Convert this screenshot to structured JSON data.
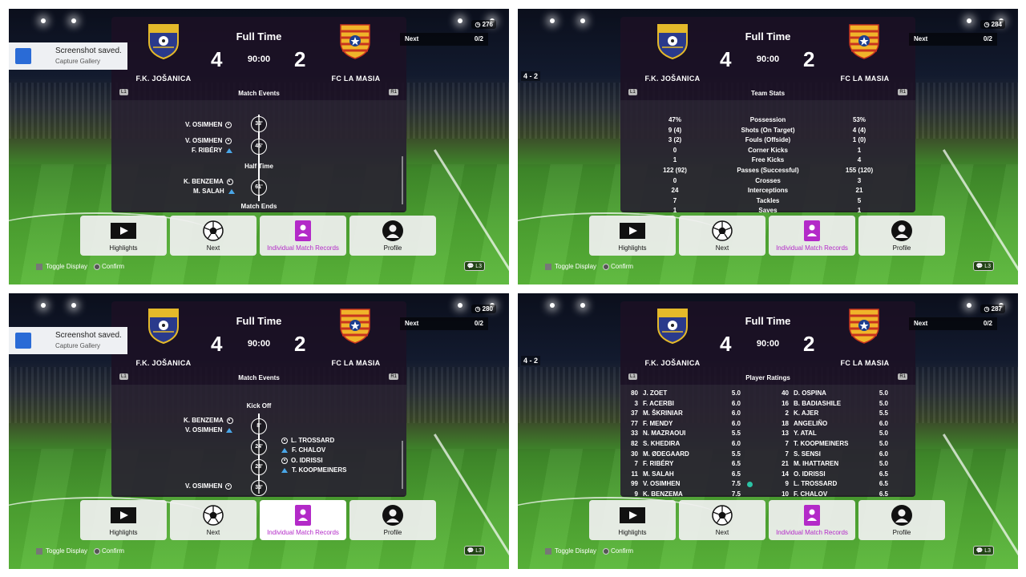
{
  "header": {
    "fulltime": "Full Time",
    "clock": "90:00",
    "home_team": "F.K. JOŠANICA",
    "away_team": "FC LA MASIA",
    "home_score": "4",
    "away_score": "2",
    "l1": "L1",
    "r1": "R1"
  },
  "nav": {
    "next_label": "Next",
    "next_count": "0/2"
  },
  "buttons": {
    "highlights": "Highlights",
    "next": "Next",
    "records": "Individual Match Records",
    "profile": "Profile"
  },
  "footer": {
    "toggle": "Toggle Display",
    "confirm": "Confirm",
    "l3": "L3"
  },
  "toast": {
    "title": "Screenshot saved.",
    "subtitle": "Capture Gallery"
  },
  "thumb_score": "4 - 2",
  "panels": [
    {
      "viewers": "276",
      "section": "Match Events",
      "half_time": "Half Time",
      "match_ends": "Match Ends",
      "events": [
        {
          "home": "V. OSIMHEN",
          "minute": "33'"
        },
        {
          "home": "V. OSIMHEN",
          "home2": "F. RIBÉRY",
          "minute": "45'"
        },
        {
          "home": "K. BENZEMA",
          "home2": "M. SALAH",
          "minute": "61'"
        }
      ]
    },
    {
      "viewers": "284",
      "section": "Team Stats",
      "stats": [
        {
          "l": "47%",
          "m": "Possession",
          "r": "53%"
        },
        {
          "l": "9 (4)",
          "m": "Shots (On Target)",
          "r": "4 (4)"
        },
        {
          "l": "3 (2)",
          "m": "Fouls (Offside)",
          "r": "1 (0)"
        },
        {
          "l": "0",
          "m": "Corner Kicks",
          "r": "1"
        },
        {
          "l": "1",
          "m": "Free Kicks",
          "r": "4"
        },
        {
          "l": "122 (92)",
          "m": "Passes (Successful)",
          "r": "155 (120)"
        },
        {
          "l": "0",
          "m": "Crosses",
          "r": "3"
        },
        {
          "l": "24",
          "m": "Interceptions",
          "r": "21"
        },
        {
          "l": "7",
          "m": "Tackles",
          "r": "5"
        },
        {
          "l": "1",
          "m": "Saves",
          "r": "1"
        }
      ]
    },
    {
      "viewers": "280",
      "section": "Match Events",
      "kick_off": "Kick Off",
      "events": [
        {
          "home": "K. BENZEMA",
          "home2": "V. OSIMHEN",
          "minute": "8'"
        },
        {
          "away": "L. TROSSARD",
          "away2": "F. CHALOV",
          "minute": "24'"
        },
        {
          "away": "O. IDRISSI",
          "away2": "T. KOOPMEINERS",
          "minute": "28'"
        },
        {
          "home": "V. OSIMHEN",
          "minute": "33'"
        }
      ]
    },
    {
      "viewers": "287",
      "section": "Player Ratings",
      "home_ratings": [
        {
          "n": "80",
          "nm": "J. ZOET",
          "rt": "5.0"
        },
        {
          "n": "3",
          "nm": "F. ACERBI",
          "rt": "6.0"
        },
        {
          "n": "37",
          "nm": "M. ŠKRINIAR",
          "rt": "6.0"
        },
        {
          "n": "77",
          "nm": "F. MENDY",
          "rt": "6.0"
        },
        {
          "n": "33",
          "nm": "N. MAZRAOUI",
          "rt": "5.5"
        },
        {
          "n": "82",
          "nm": "S. KHEDIRA",
          "rt": "6.0"
        },
        {
          "n": "30",
          "nm": "M. ØDEGAARD",
          "rt": "5.5"
        },
        {
          "n": "7",
          "nm": "F. RIBÉRY",
          "rt": "6.5"
        },
        {
          "n": "11",
          "nm": "M. SALAH",
          "rt": "6.5"
        },
        {
          "n": "99",
          "nm": "V. OSIMHEN",
          "rt": "7.5"
        },
        {
          "n": "9",
          "nm": "K. BENZEMA",
          "rt": "7.5"
        }
      ],
      "away_ratings": [
        {
          "n": "40",
          "nm": "D. OSPINA",
          "rt": "5.0"
        },
        {
          "n": "16",
          "nm": "B. BADIASHILE",
          "rt": "5.0"
        },
        {
          "n": "2",
          "nm": "K. AJER",
          "rt": "5.5"
        },
        {
          "n": "18",
          "nm": "ANGELIÑO",
          "rt": "6.0"
        },
        {
          "n": "13",
          "nm": "Y. ATAL",
          "rt": "5.0"
        },
        {
          "n": "7",
          "nm": "T. KOOPMEINERS",
          "rt": "5.0"
        },
        {
          "n": "7",
          "nm": "S. SENSI",
          "rt": "6.0"
        },
        {
          "n": "21",
          "nm": "M. IHATTAREN",
          "rt": "5.0"
        },
        {
          "n": "14",
          "nm": "O. IDRISSI",
          "rt": "6.5"
        },
        {
          "n": "9",
          "nm": "L. TROSSARD",
          "rt": "6.5"
        },
        {
          "n": "10",
          "nm": "F. CHALOV",
          "rt": "6.5"
        }
      ]
    }
  ]
}
